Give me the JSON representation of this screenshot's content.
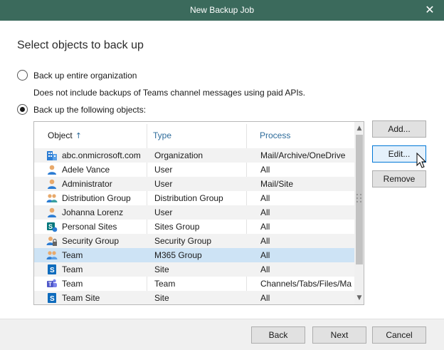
{
  "window": {
    "title": "New Backup Job"
  },
  "heading": "Select objects to back up",
  "options": {
    "entire_org": {
      "label": "Back up entire organization",
      "checked": false
    },
    "note": "Does not include backups of Teams channel messages using paid APIs.",
    "following": {
      "label": "Back up the following objects:",
      "checked": true
    }
  },
  "table": {
    "columns": {
      "object": "Object",
      "type": "Type",
      "process": "Process"
    },
    "sort_arrow": "↑",
    "rows": [
      {
        "object": "abc.onmicrosoft.com",
        "type": "Organization",
        "process": "Mail/Archive/OneDrive",
        "icon": "organization-icon"
      },
      {
        "object": "Adele Vance",
        "type": "User",
        "process": "All",
        "icon": "user-icon"
      },
      {
        "object": "Administrator",
        "type": "User",
        "process": "Mail/Site",
        "icon": "user-icon"
      },
      {
        "object": "Distribution Group",
        "type": "Distribution Group",
        "process": "All",
        "icon": "group-icon"
      },
      {
        "object": "Johanna Lorenz",
        "type": "User",
        "process": "All",
        "icon": "user-icon"
      },
      {
        "object": "Personal Sites",
        "type": "Sites Group",
        "process": "All",
        "icon": "sites-group-icon"
      },
      {
        "object": "Security Group",
        "type": "Security Group",
        "process": "All",
        "icon": "security-group-icon"
      },
      {
        "object": "Team",
        "type": "M365 Group",
        "process": "All",
        "icon": "m365-group-icon"
      },
      {
        "object": "Team",
        "type": "Site",
        "process": "All",
        "icon": "sharepoint-site-icon"
      },
      {
        "object": "Team",
        "type": "Team",
        "process": "Channels/Tabs/Files/Mail",
        "icon": "teams-icon"
      },
      {
        "object": "Team Site",
        "type": "Site",
        "process": "All",
        "icon": "sharepoint-site-icon"
      }
    ],
    "selected_index": 7
  },
  "buttons": {
    "add": "Add...",
    "edit": "Edit...",
    "remove": "Remove",
    "back": "Back",
    "next": "Next",
    "cancel": "Cancel"
  },
  "colors": {
    "titlebar": "#3b6a5c",
    "selected_row": "#cde3f5",
    "header_link": "#2e6c9b",
    "focus": "#0078d7"
  }
}
